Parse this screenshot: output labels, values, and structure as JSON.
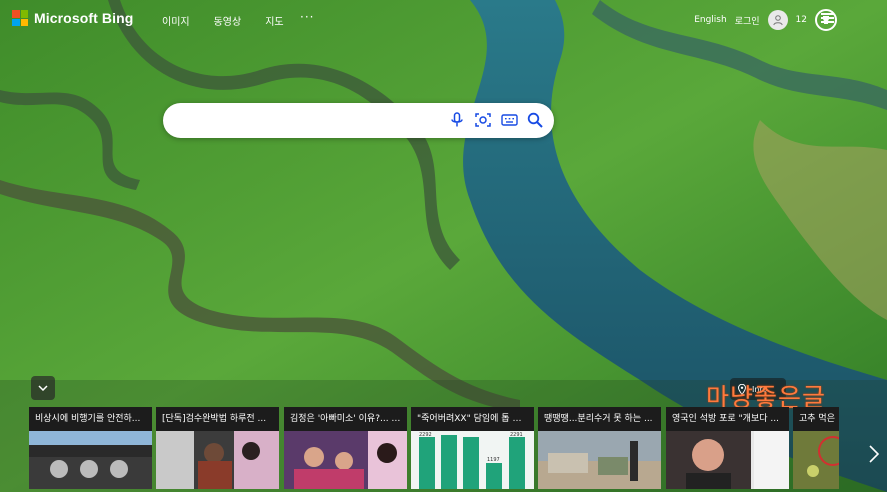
{
  "brand": {
    "name": "Microsoft Bing",
    "colors": [
      "#f25022",
      "#7fba00",
      "#00a4ef",
      "#ffb900"
    ]
  },
  "nav": {
    "items": [
      "이미지",
      "동영상",
      "지도"
    ],
    "more": "···"
  },
  "header": {
    "language": "English",
    "login": "로그인",
    "rewards_count": "12",
    "avatar_icon": "user-icon",
    "rewards_icon": "trophy-icon",
    "menu_icon": "hamburger-icon"
  },
  "search": {
    "placeholder": "",
    "icons": [
      "microphone-icon",
      "visual-search-icon",
      "keyboard-icon",
      "search-icon"
    ]
  },
  "image_info": {
    "label": "Info",
    "icon": "location-pin-icon"
  },
  "watermark": {
    "text": "마냥좋은글"
  },
  "news": {
    "cards": [
      {
        "title": "비상시에 비행기를 안전하..."
      },
      {
        "title": "[단독]검수완박법 하루전 ..."
      },
      {
        "title": "김정은 '아빠미소' 이유?... \"..."
      },
      {
        "title": "\"죽어버려XX\" 담임에 톱 들..."
      },
      {
        "title": "땡땡땡...분리수거 못 하는 ..."
      },
      {
        "title": "영국인 석방 포로 \"개보다 ..."
      },
      {
        "title": "고추 먹은"
      }
    ],
    "chart_labels": [
      "2292",
      "1197",
      "2291"
    ],
    "next_icon": "chevron-right-icon",
    "collapse_icon": "chevron-down-icon"
  }
}
